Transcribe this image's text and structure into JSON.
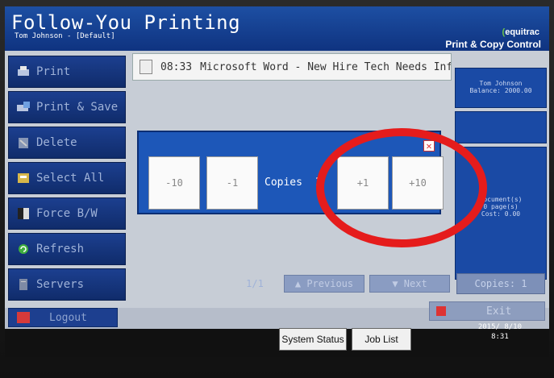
{
  "header": {
    "app_title": "Follow-You Printing",
    "user_line": "Tom Johnson - [Default]",
    "brand_name": "equitrac",
    "product_name": "Print & Copy Control"
  },
  "sidebar": {
    "items": [
      {
        "label": "Print",
        "icon": "print-icon"
      },
      {
        "label": "Print & Save",
        "icon": "print-save-icon"
      },
      {
        "label": "Delete",
        "icon": "delete-icon"
      },
      {
        "label": "Select All",
        "icon": "select-all-icon"
      },
      {
        "label": "Force B/W",
        "icon": "force-bw-icon"
      },
      {
        "label": "Refresh",
        "icon": "refresh-icon"
      },
      {
        "label": "Servers",
        "icon": "servers-icon"
      }
    ],
    "logout_label": "Logout"
  },
  "job_list": {
    "rows": [
      {
        "time": "08:33",
        "title": "Microsoft Word - New Hire Tech Needs Informat..."
      }
    ],
    "page_indicator": "1/1",
    "previous_label": "Previous",
    "next_label": "Next"
  },
  "account_panel": {
    "user": "Tom Johnson",
    "balance": "Balance: 2000.00",
    "documents": "document(s)",
    "pages": "0 page(s)",
    "cost": "Cost: 0.00",
    "copies_button": "Copies: 1"
  },
  "copies_dialog": {
    "minus10": "-10",
    "minus1": "-1",
    "copies_label": "Copies",
    "copies_value": "1",
    "plus1": "+1",
    "plus10": "+10"
  },
  "footer": {
    "exit_label": "Exit",
    "system_status_label": "System Status",
    "job_list_label": "Job List",
    "date": "2015/ 8/10",
    "time": "8:31"
  },
  "colors": {
    "header_blue": "#1d4fa3",
    "dialog_blue": "#1d57b8",
    "annotation_red": "#e51c1c",
    "brand_green": "#6fc54a"
  }
}
